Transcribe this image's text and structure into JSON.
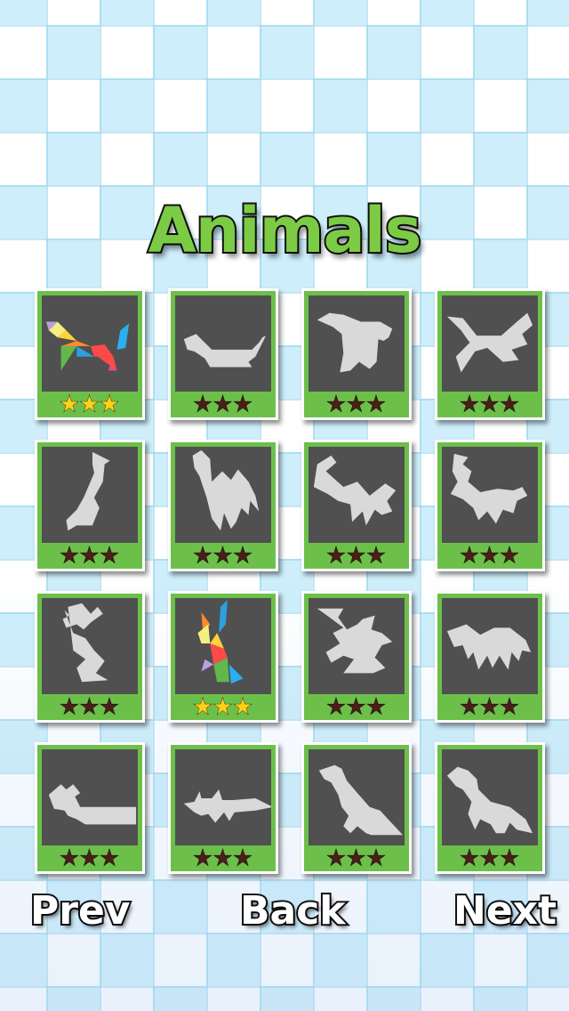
{
  "category_title": "Animals",
  "levels": [
    {
      "stars": 3,
      "solved": true,
      "shape": "dog-colored"
    },
    {
      "stars": 0,
      "solved": false,
      "shape": "cat"
    },
    {
      "stars": 0,
      "solved": false,
      "shape": "horse"
    },
    {
      "stars": 0,
      "solved": false,
      "shape": "fox"
    },
    {
      "stars": 0,
      "solved": false,
      "shape": "giraffe"
    },
    {
      "stars": 0,
      "solved": false,
      "shape": "camel"
    },
    {
      "stars": 0,
      "solved": false,
      "shape": "goat"
    },
    {
      "stars": 0,
      "solved": false,
      "shape": "deer"
    },
    {
      "stars": 0,
      "solved": false,
      "shape": "rabbit"
    },
    {
      "stars": 3,
      "solved": true,
      "shape": "rabbit-colored"
    },
    {
      "stars": 0,
      "solved": false,
      "shape": "squirrel"
    },
    {
      "stars": 0,
      "solved": false,
      "shape": "bear"
    },
    {
      "stars": 0,
      "solved": false,
      "shape": "crocodile"
    },
    {
      "stars": 0,
      "solved": false,
      "shape": "wolf"
    },
    {
      "stars": 0,
      "solved": false,
      "shape": "kangaroo"
    },
    {
      "stars": 0,
      "solved": false,
      "shape": "dinosaur"
    }
  ],
  "nav": {
    "prev_label": "Prev",
    "back_label": "Back",
    "next_label": "Next"
  },
  "colors": {
    "accent_green": "#6cc04a",
    "star_earned": "#ffd21a",
    "star_empty": "#4a1f18",
    "thumb_bg": "#505050",
    "silhouette": "#d9d9d9"
  },
  "icons": {
    "star_glyph": "★"
  }
}
